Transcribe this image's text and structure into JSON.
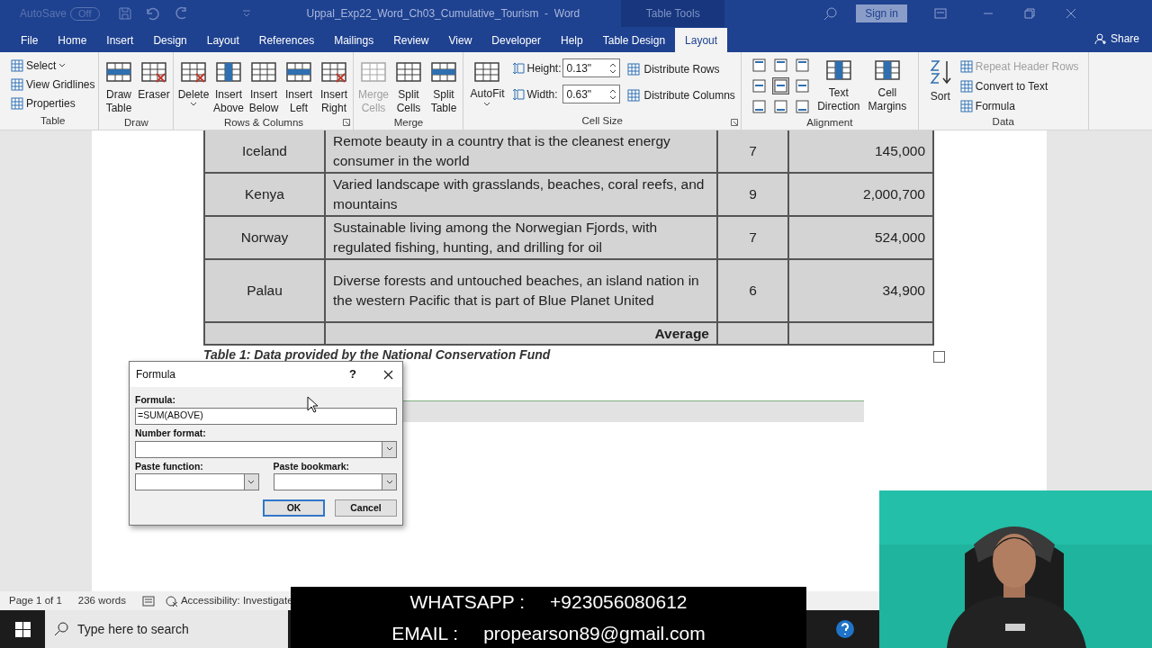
{
  "title_bar": {
    "autosave": "AutoSave",
    "autosave_toggle": "Off",
    "document_title": "Uppal_Exp22_Word_Ch03_Cumulative_Tourism  -  Word",
    "context_label": "Table Tools",
    "sign_in": "Sign in"
  },
  "menu_tabs": [
    {
      "label": "File",
      "selected": false
    },
    {
      "label": "Home",
      "selected": false
    },
    {
      "label": "Insert",
      "selected": false
    },
    {
      "label": "Design",
      "selected": false
    },
    {
      "label": "Layout",
      "selected": false
    },
    {
      "label": "References",
      "selected": false
    },
    {
      "label": "Mailings",
      "selected": false
    },
    {
      "label": "Review",
      "selected": false
    },
    {
      "label": "View",
      "selected": false
    },
    {
      "label": "Developer",
      "selected": false
    },
    {
      "label": "Help",
      "selected": false
    },
    {
      "label": "Table Design",
      "selected": false
    },
    {
      "label": "Layout",
      "selected": true
    }
  ],
  "share": "Share",
  "ribbon_groups": [
    {
      "title": "Table",
      "kind": "small",
      "items": [
        {
          "label": "Select",
          "dropdown": true,
          "disabled": false
        },
        {
          "label": "View Gridlines",
          "dropdown": false,
          "disabled": false
        },
        {
          "label": "Properties",
          "dropdown": false,
          "disabled": false
        }
      ]
    },
    {
      "title": "Draw",
      "kind": "large",
      "items": [
        {
          "label": "Draw Table",
          "dropdown": false,
          "disabled": false
        },
        {
          "label": "Eraser",
          "dropdown": false,
          "disabled": false
        }
      ]
    },
    {
      "title": "Rows & Columns",
      "kind": "large",
      "launcher": true,
      "items": [
        {
          "label": "Delete",
          "dropdown": true,
          "disabled": false
        },
        {
          "label": "Insert Above",
          "dropdown": false,
          "disabled": false
        },
        {
          "label": "Insert Below",
          "dropdown": false,
          "disabled": false
        },
        {
          "label": "Insert Left",
          "dropdown": false,
          "disabled": false
        },
        {
          "label": "Insert Right",
          "dropdown": false,
          "disabled": false
        }
      ]
    },
    {
      "title": "Merge",
      "kind": "large",
      "items": [
        {
          "label": "Merge Cells",
          "dropdown": false,
          "disabled": true
        },
        {
          "label": "Split Cells",
          "dropdown": false,
          "disabled": false
        },
        {
          "label": "Split Table",
          "dropdown": false,
          "disabled": false
        }
      ]
    },
    {
      "title": "Cell Size",
      "kind": "size",
      "launcher": true,
      "autofit": "AutoFit",
      "height_label": "Height:",
      "height_value": "0.13\"",
      "width_label": "Width:",
      "width_value": "0.63\"",
      "items": [
        {
          "label": "Distribute Rows",
          "dropdown": false,
          "disabled": false
        },
        {
          "label": "Distribute Columns",
          "dropdown": false,
          "disabled": false
        }
      ]
    },
    {
      "title": "Alignment",
      "kind": "align",
      "align": [
        {
          "selected": false
        },
        {
          "selected": false
        },
        {
          "selected": false
        },
        {
          "selected": false
        },
        {
          "selected": true
        },
        {
          "selected": false
        },
        {
          "selected": false
        },
        {
          "selected": false
        },
        {
          "selected": false
        }
      ],
      "items": [
        {
          "label": "Text Direction",
          "dropdown": false,
          "disabled": false
        },
        {
          "label": "Cell Margins",
          "dropdown": false,
          "disabled": false
        }
      ]
    },
    {
      "title": "Data",
      "kind": "data",
      "sort": "Sort",
      "items": [
        {
          "label": "Repeat Header Rows",
          "dropdown": false,
          "disabled": true
        },
        {
          "label": "Convert to Text",
          "dropdown": false,
          "disabled": false
        },
        {
          "label": "Formula",
          "dropdown": false,
          "disabled": false
        }
      ]
    }
  ],
  "table": {
    "rows": [
      {
        "country": "Iceland",
        "description": "Remote beauty in a country that is the cleanest energy consumer in the world",
        "rating": "7",
        "visitors": "145,000"
      },
      {
        "country": "Kenya",
        "description": "Varied landscape with grasslands, beaches, coral reefs, and mountains",
        "rating": "9",
        "visitors": "2,000,700"
      },
      {
        "country": "Norway",
        "description": "Sustainable living among the Norwegian Fjords, with regulated fishing, hunting, and drilling for oil",
        "rating": "7",
        "visitors": "524,000"
      },
      {
        "country": "Palau",
        "description": "Diverse forests and untouched beaches, an island nation in the western Pacific that is part of Blue Planet United",
        "rating": "6",
        "visitors": "34,900"
      }
    ],
    "total_label": "Average",
    "caption": "Table 1: Data provided by the National Conservation Fund"
  },
  "dialog": {
    "title": "Formula",
    "help": "?",
    "formula_label": "Formula:",
    "formula_value": "=SUM(ABOVE)",
    "number_format_label": "Number format:",
    "paste_function_label": "Paste function:",
    "paste_bookmark_label": "Paste bookmark:",
    "ok": "OK",
    "cancel": "Cancel"
  },
  "status_bar": {
    "page": "Page 1 of 1",
    "words": "236 words",
    "accessibility": "Accessibility: Investigate"
  },
  "taskbar": {
    "search_placeholder": "Type here to search"
  },
  "contact_banner": [
    {
      "label": "WHATSAPP :",
      "value": "+923056080612"
    },
    {
      "label": "EMAIL :",
      "value": "propearson89@gmail.com"
    }
  ]
}
